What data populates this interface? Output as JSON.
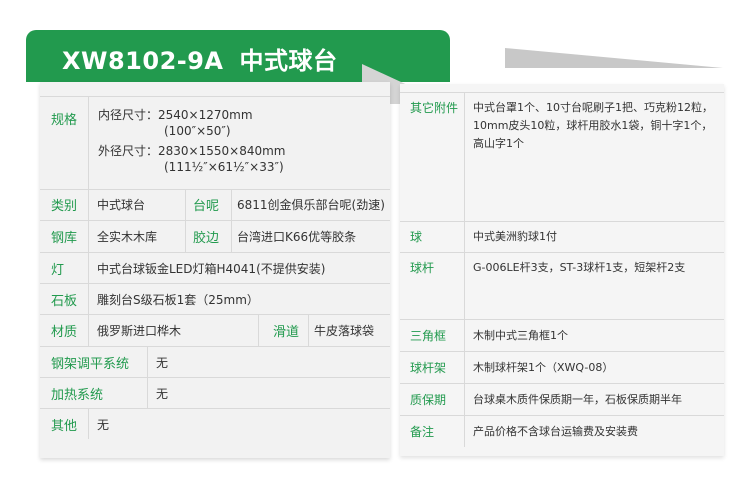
{
  "header": {
    "model": "XW8102-9A",
    "name": "中式球台"
  },
  "left": {
    "spec": {
      "label": "规格",
      "inner_label": "内径尺寸：",
      "inner_mm": "2540×1270mm",
      "inner_in": "(100″×50″)",
      "outer_label": "外径尺寸：",
      "outer_mm": "2830×1550×840mm",
      "outer_in": "(111½″×61½″×33″)"
    },
    "category": {
      "label": "类别",
      "value": "中式球台",
      "label2": "台呢",
      "value2": "6811创金俱乐部台呢(劲速)"
    },
    "frame": {
      "label": "钢库",
      "value": "全实木木库",
      "label2": "胶边",
      "value2": "台湾进口K66优等胶条"
    },
    "light": {
      "label": "灯",
      "value": "中式台球钣金LED灯箱H4041(不提供安装)"
    },
    "slate": {
      "label": "石板",
      "value": "雕刻台S级石板1套（25mm）"
    },
    "material": {
      "label": "材质",
      "value": "俄罗斯进口桦木",
      "label2": "滑道",
      "value2": "牛皮落球袋"
    },
    "leveling": {
      "label": "钢架调平系统",
      "value": "无"
    },
    "heating": {
      "label": "加热系统",
      "value": "无"
    },
    "other": {
      "label": "其他",
      "value": "无"
    }
  },
  "right": {
    "accessories": {
      "label": "其它附件",
      "value": "中式台罩1个、10寸台呢刷子1把、巧克粉12粒，10mm皮头10粒，球杆用胶水1袋，铜十字1个，高山字1个"
    },
    "balls": {
      "label": "球",
      "value": "中式美洲豹球1付"
    },
    "cues": {
      "label": "球杆",
      "value": "G-006LE杆3支，ST-3球杆1支，短架杆2支"
    },
    "triangle": {
      "label": "三角框",
      "value": "木制中式三角框1个"
    },
    "cue_rack": {
      "label": "球杆架",
      "value": "木制球杆架1个（XWQ-08）"
    },
    "warranty": {
      "label": "质保期",
      "value": "台球桌木质件保质期一年，石板保质期半年"
    },
    "remarks": {
      "label": "备注",
      "value": "产品价格不含球台运输费及安装费"
    }
  },
  "colors": {
    "accent": "#229a4e",
    "panel": "#f2f2f2"
  }
}
